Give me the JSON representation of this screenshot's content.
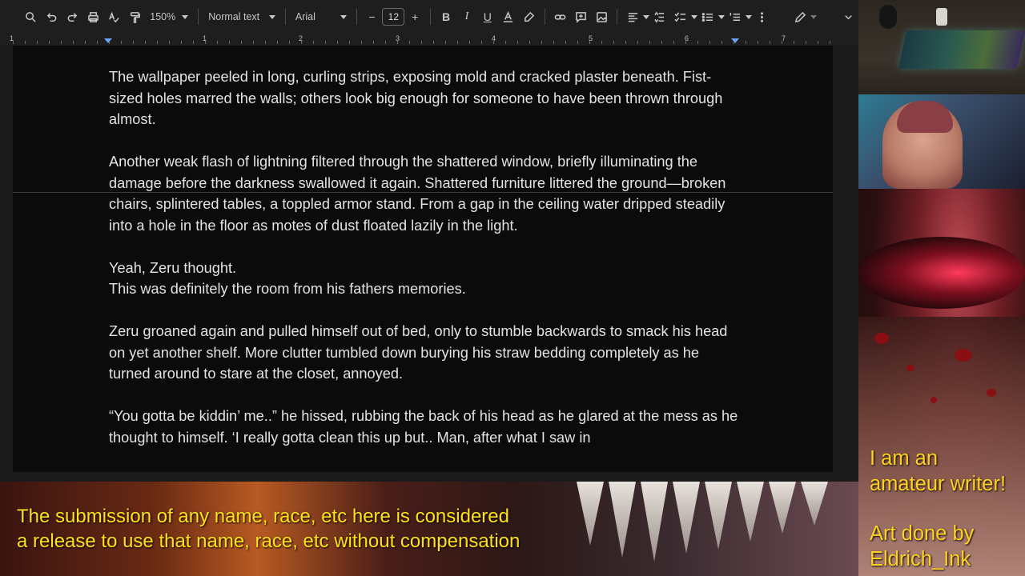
{
  "toolbar": {
    "zoom": "150%",
    "style": "Normal text",
    "font": "Arial",
    "font_size": "12"
  },
  "ruler": {
    "numbers": [
      "1",
      "1",
      "2",
      "3",
      "4",
      "5",
      "6",
      "7"
    ]
  },
  "document": {
    "paragraphs": [
      "The wallpaper peeled in long, curling strips, exposing mold and cracked plaster beneath. Fist-sized holes marred the walls; others look big enough for someone to have been thrown through almost.",
      "Another weak flash of lightning filtered through the shattered window, briefly illuminating the damage before the darkness swallowed it again. Shattered furniture littered the ground—broken chairs, splintered tables, a toppled armor stand. From a gap in the ceiling water dripped steadily into a hole in the floor as motes of dust floated lazily in the light.",
      "Yeah, Zeru thought.",
      "This was definitely the room from his fathers memories.",
      "Zeru groaned again and pulled himself out of bed, only to stumble backwards to smack his head on yet another shelf. More clutter tumbled down burying his straw bedding completely as he turned around to stare at the closet, annoyed.",
      "“You gotta be kiddin’ me..” he hissed, rubbing the back of his head as he glared at the mess as he thought to himself. ‘I really gotta clean this up but.. Man, after what I saw in"
    ]
  },
  "overlay": {
    "disclaimer_line1": "The submission of any name, race, etc here is considered",
    "disclaimer_line2": "a release to use that name, race, etc without compensation",
    "note_line1": "I am an",
    "note_line2": "amateur writer!",
    "note_line3": "Art done by",
    "note_line4": "Eldrich_Ink"
  },
  "colors": {
    "overlay_text": "#ffe11a",
    "ruler_marker": "#6ea3ff",
    "page_bg": "#0b0b0b"
  }
}
